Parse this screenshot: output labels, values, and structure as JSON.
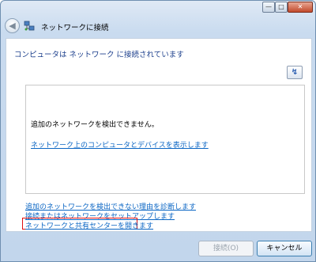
{
  "window": {
    "title": "ネットワークに接続",
    "controls": {
      "minimize": "—",
      "maximize": "□",
      "close": "✕"
    }
  },
  "nav": {
    "back_icon": "back-arrow-icon",
    "back_glyph": "◀",
    "network_icon": "network-computers-icon"
  },
  "status_heading": "コンピュータは ネットワーク に接続されています",
  "refresh": {
    "icon": "refresh-icon",
    "glyph": "↯"
  },
  "network_list": {
    "message": "追加のネットワークを検出できません。",
    "link": "ネットワーク上のコンピュータとデバイスを表示します"
  },
  "tasks": {
    "diagnose": "追加のネットワークを検出できない理由を診断します",
    "setup": "接続またはネットワークをセットアップします",
    "sharing_center": "ネットワークと共有センターを開きます"
  },
  "buttons": {
    "connect": "接続(O)",
    "cancel": "キャンセル"
  },
  "colors": {
    "link": "#0b66c4",
    "heading": "#1c3f8c",
    "highlight": "#e01010"
  }
}
